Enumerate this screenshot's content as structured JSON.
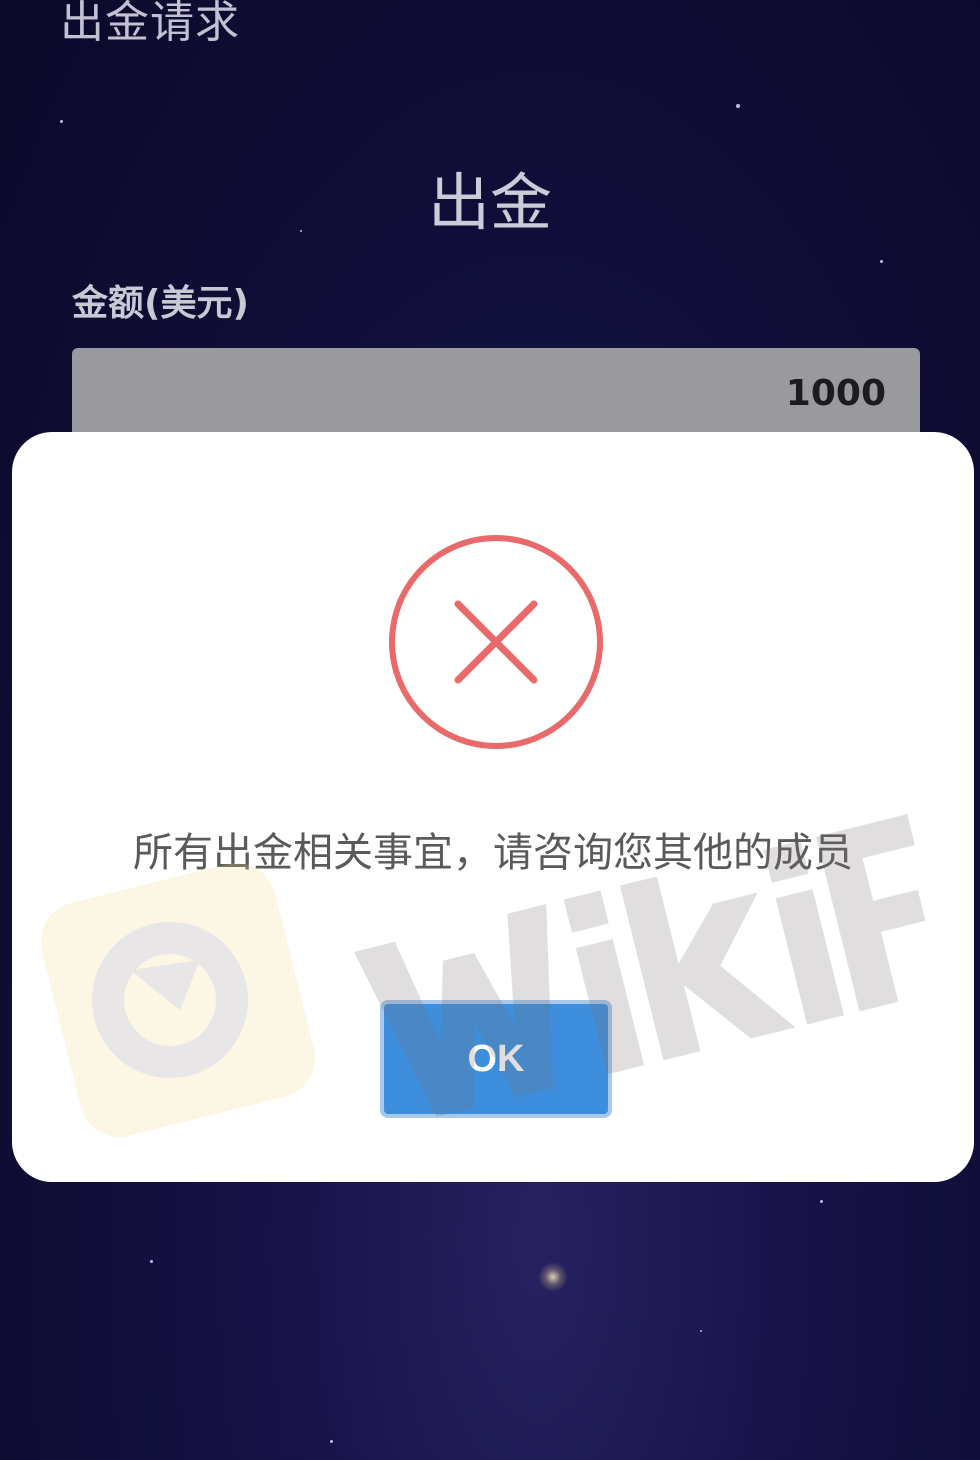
{
  "page": {
    "header_title": "出金请求",
    "section_title": "出金"
  },
  "form": {
    "amount_label": "金额(美元)",
    "amount_value": "1000"
  },
  "dialog": {
    "icon": "error-x-circle-icon",
    "message": "所有出金相关事宜，请咨询您其他的成员",
    "ok_label": "OK"
  },
  "colors": {
    "error_red": "#e86a6a",
    "button_blue": "#3d8fdd",
    "background_navy": "#120f3c"
  }
}
